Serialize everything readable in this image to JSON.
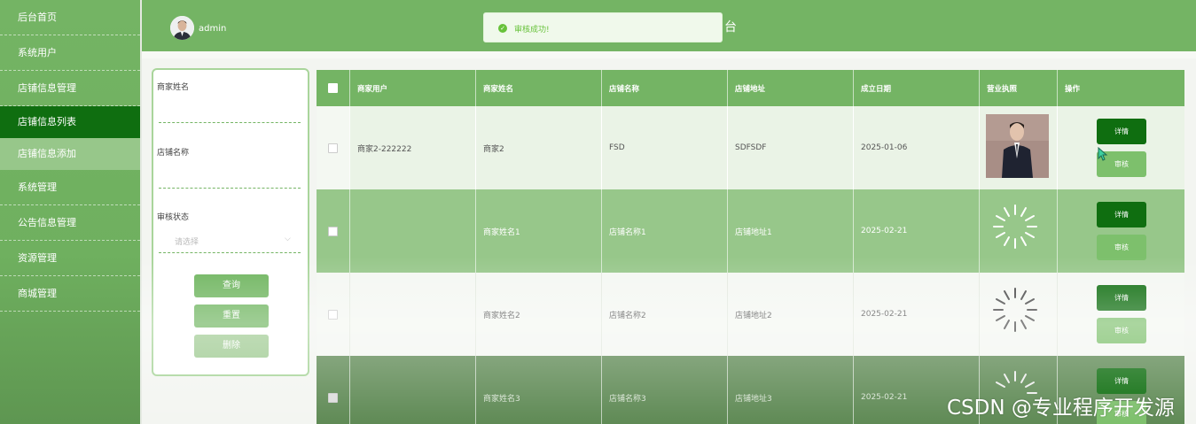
{
  "sidebar": {
    "items": [
      "后台首页",
      "系统用户",
      "店铺信息管理",
      "店铺信息列表",
      "店铺信息添加",
      "系统管理",
      "公告信息管理",
      "资源管理",
      "商城管理"
    ]
  },
  "header": {
    "user": "admin",
    "title_fragment": "台"
  },
  "toast": {
    "message": "审核成功!"
  },
  "search": {
    "fields": [
      {
        "label": "商家姓名"
      },
      {
        "label": "店铺名称"
      },
      {
        "label": "审核状态",
        "placeholder": "请选择"
      }
    ],
    "buttons": {
      "query": "查询",
      "reset": "重置",
      "delete": "删除"
    }
  },
  "table": {
    "headers": [
      "商家用户",
      "商家姓名",
      "店铺名称",
      "店铺地址",
      "成立日期",
      "营业执照",
      "操作"
    ],
    "rows": [
      {
        "user": "商家2-222222",
        "name": "商家2",
        "shop": "FSD",
        "address": "SDFSDF",
        "date": "2025-01-06",
        "license": "photo",
        "detail": "详情",
        "audit": "审核"
      },
      {
        "user": "",
        "name": "商家姓名1",
        "shop": "店铺名称1",
        "address": "店铺地址1",
        "date": "2025-02-21",
        "license": "loading",
        "detail": "详情",
        "audit": "审核"
      },
      {
        "user": "",
        "name": "商家姓名2",
        "shop": "店铺名称2",
        "address": "店铺地址2",
        "date": "2025-02-21",
        "license": "loading",
        "detail": "详情",
        "audit": "审核"
      },
      {
        "user": "",
        "name": "商家姓名3",
        "shop": "店铺名称3",
        "address": "店铺地址3",
        "date": "2025-02-21",
        "license": "loading",
        "detail": "详情",
        "audit": "审核"
      }
    ]
  },
  "watermark": "CSDN @专业程序开发源",
  "colors": {
    "primary": "#74b464",
    "dark": "#0f6e10",
    "light": "#97c78a",
    "success": "#67c23a"
  }
}
